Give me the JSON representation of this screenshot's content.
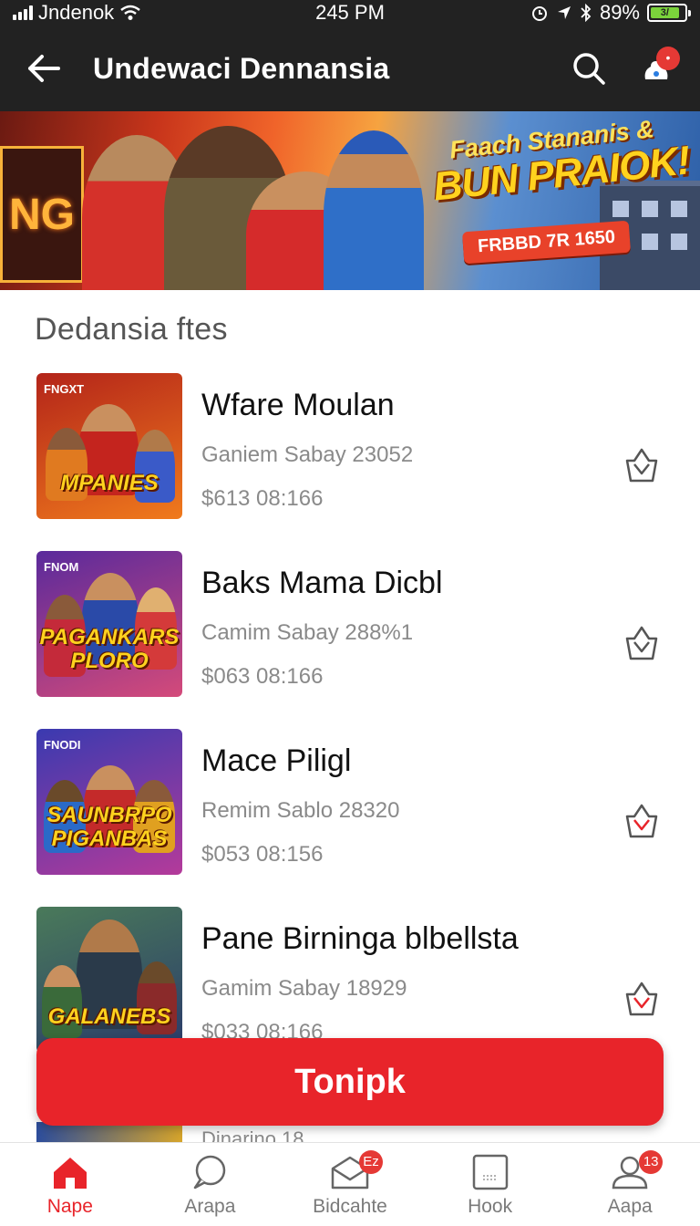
{
  "status_bar": {
    "carrier": "Jndenok",
    "time": "245 PM",
    "battery_percent": "89%",
    "battery_label": "3/"
  },
  "header": {
    "title": "Undewaci Dennansia",
    "back_icon": "back-arrow-icon",
    "search_icon": "search-icon",
    "notification_icon": "notification-icon"
  },
  "banner": {
    "sign_text": "NG",
    "subtitle": "Faach Stananis &",
    "title": "BUN PRAIOK!",
    "pill": "FRBBD 7R 1650"
  },
  "section": {
    "title": "Dedansia  ftes"
  },
  "items": [
    {
      "title": "Wfare Moulan",
      "subtitle": "Ganiem Sabay 23052",
      "price": "$613 08:166",
      "thumb_tag": "FNGXT",
      "thumb_word": "MPANIES",
      "colors": [
        "#b3241a",
        "#f07a1c"
      ]
    },
    {
      "title": "Baks Mama Dicbl",
      "subtitle": "Camim Sabay 288%1",
      "price": "$063 08:166",
      "thumb_tag": "FNOM",
      "thumb_word": "PAGANKARS PLORO",
      "colors": [
        "#5a2a9c",
        "#d44a7a"
      ]
    },
    {
      "title": "Mace Piligl",
      "subtitle": "Remim Sablo 28320",
      "price": "$053 08:156",
      "thumb_tag": "FNODI",
      "thumb_word": "SAUNBRPO PIGANBAS",
      "colors": [
        "#3a3ab0",
        "#b43a9a"
      ]
    },
    {
      "title": "Pane Birninga blbellsta",
      "subtitle": "Gamim Sabay 18929",
      "price": "$033 08:166",
      "thumb_tag": "",
      "thumb_word": "GALANEBS",
      "colors": [
        "#4a7a5a",
        "#2a3a6a"
      ]
    }
  ],
  "peek_item": {
    "subtitle": "Dinarino 18"
  },
  "primary_button": {
    "label": "Tonipk"
  },
  "bottom_nav": [
    {
      "label": "Nape",
      "icon": "home-icon",
      "active": true,
      "badge": ""
    },
    {
      "label": "Arapa",
      "icon": "chat-bubble-icon",
      "active": false,
      "badge": ""
    },
    {
      "label": "Bidcahte",
      "icon": "mail-icon",
      "active": false,
      "badge": "Ez"
    },
    {
      "label": "Hook",
      "icon": "tablet-icon",
      "active": false,
      "badge": ""
    },
    {
      "label": "Aapa",
      "icon": "profile-icon",
      "active": false,
      "badge": "13"
    }
  ],
  "accent_color": "#e8242a"
}
